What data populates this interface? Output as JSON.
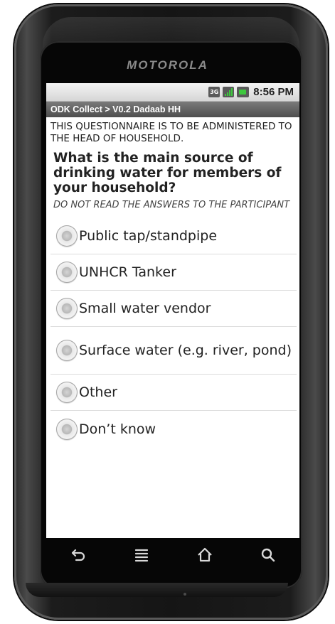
{
  "device": {
    "brand": "MOTOROLA"
  },
  "status_bar": {
    "time": "8:56 PM",
    "network_label": "3G",
    "icons": [
      "3g-icon",
      "signal-icon",
      "battery-icon"
    ]
  },
  "app_bar": {
    "title": "ODK Collect > V0.2 Dadaab HH"
  },
  "form": {
    "preamble": "THIS QUESTIONNAIRE IS TO BE ADMINISTERED TO THE HEAD OF HOUSEHOLD.",
    "question": "What is the main source of drinking water for members of your household?",
    "hint": "DO NOT READ THE ANSWERS TO THE PARTICIPANT",
    "options": [
      {
        "label": "Public tap/standpipe",
        "selected": false
      },
      {
        "label": "UNHCR Tanker",
        "selected": false
      },
      {
        "label": "Small water vendor",
        "selected": false
      },
      {
        "label": "Surface water (e.g. river, pond)",
        "selected": false
      },
      {
        "label": "Other",
        "selected": false
      },
      {
        "label": "Don’t know",
        "selected": false
      }
    ]
  },
  "nav_buttons": [
    "back-icon",
    "menu-icon",
    "home-icon",
    "search-icon"
  ],
  "colors": {
    "title_bar": "#5e5e5e",
    "text": "#222222",
    "signal_green": "#3ec83e"
  }
}
